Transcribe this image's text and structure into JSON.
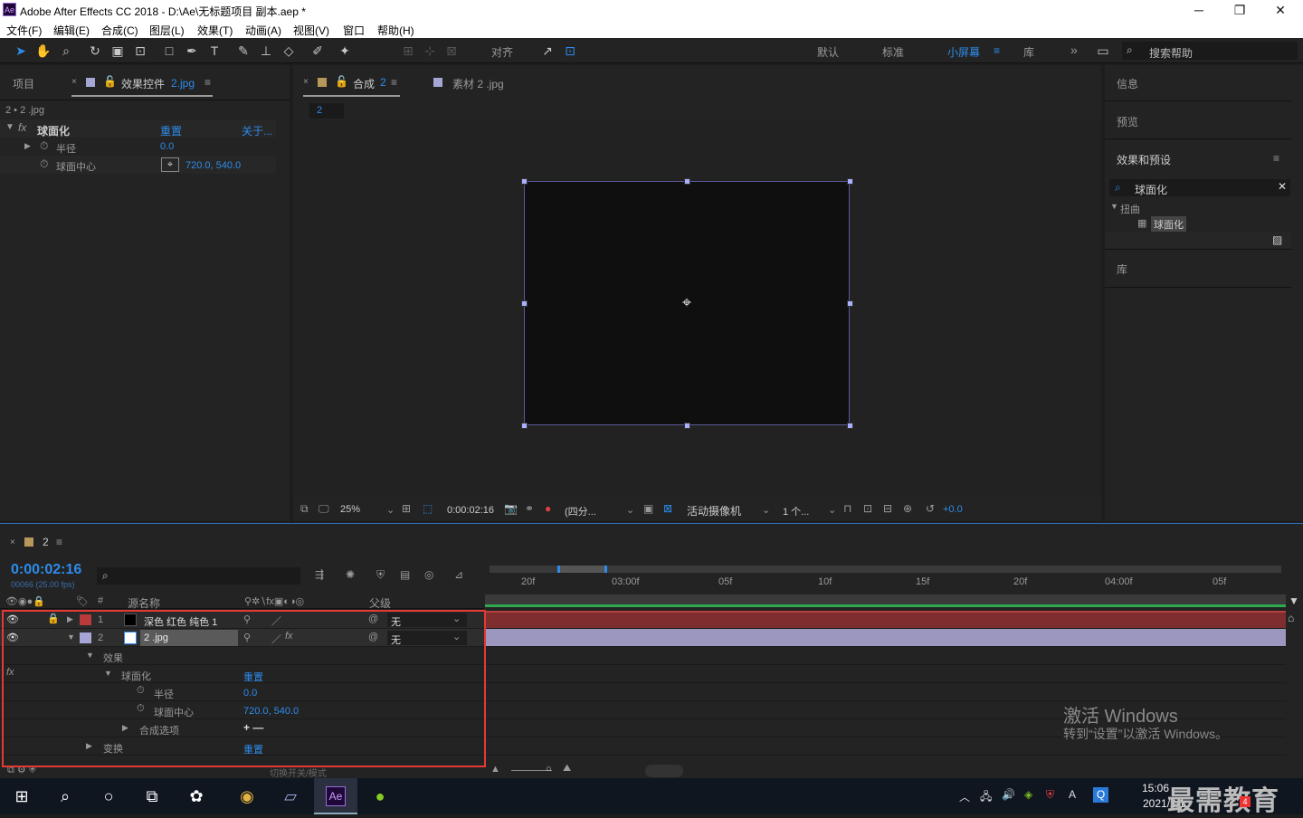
{
  "window": {
    "title": "Adobe After Effects CC 2018 - D:\\Ae\\无标题项目 副本.aep *",
    "app_icon": "Ae",
    "min": "─",
    "max": "❐",
    "close": "✕"
  },
  "menu": [
    "文件(F)",
    "编辑(E)",
    "合成(C)",
    "图层(L)",
    "效果(T)",
    "动画(A)",
    "视图(V)",
    "窗口",
    "帮助(H)"
  ],
  "toolbar": {
    "snap_label": "对齐",
    "workspaces": [
      "默认",
      "标准",
      "小屏幕",
      "库"
    ],
    "active_workspace": "小屏幕",
    "search_placeholder": "搜索帮助"
  },
  "left_panel": {
    "tab_project": "项目",
    "tab_effects": "效果控件",
    "tab_effects_file": "2.jpg",
    "layer_path": "2 • 2 .jpg",
    "effect_name": "球面化",
    "reset": "重置",
    "about": "关于...",
    "props": [
      {
        "name": "半径",
        "value": "0.0"
      },
      {
        "name": "球面中心",
        "value": "720.0, 540.0"
      }
    ]
  },
  "comp_panel": {
    "tab_comp": "合成",
    "tab_comp_num": "2",
    "tab_footage": "素材 2 .jpg",
    "comp_chip": "2",
    "zoom": "25%",
    "timecode": "0:00:02:16",
    "resolution": "(四分...",
    "camera": "活动摄像机",
    "views": "1 个...",
    "exposure": "+0.0"
  },
  "right_panel": {
    "info": "信息",
    "preview": "预览",
    "effects_presets": "效果和预设",
    "search_value": "球面化",
    "category": "扭曲",
    "result": "球面化",
    "library": "库"
  },
  "timeline": {
    "comp_name": "2",
    "timecode": "0:00:02:16",
    "fps": "00066 (25.00 fps)",
    "col_source": "源名称",
    "col_parent": "父级",
    "layers": [
      {
        "num": "1",
        "name": "深色 红色 纯色 1",
        "parent": "无",
        "color": "#b83a3a"
      },
      {
        "num": "2",
        "name": "2 .jpg",
        "parent": "无",
        "color": "#a6a6d6"
      }
    ],
    "effects_label": "效果",
    "effect_name": "球面化",
    "effect_reset": "重置",
    "radius_label": "半径",
    "radius_value": "0.0",
    "center_label": "球面中心",
    "center_value": "720.0, 540.0",
    "composite": "合成选项",
    "composite_value": "+ —",
    "transform": "变换",
    "transform_reset": "重置",
    "toggle_modes": "切换开关/模式",
    "ruler": [
      "20f",
      "03:00f",
      "05f",
      "10f",
      "15f",
      "20f",
      "04:00f",
      "05f"
    ]
  },
  "watermark": {
    "line1": "激活 Windows",
    "line2": "转到“设置”以激活 Windows。",
    "brand": "最需教育"
  },
  "taskbar": {
    "time": "15:06",
    "date": "2021/2/1",
    "ime": "A",
    "badge": "4"
  }
}
